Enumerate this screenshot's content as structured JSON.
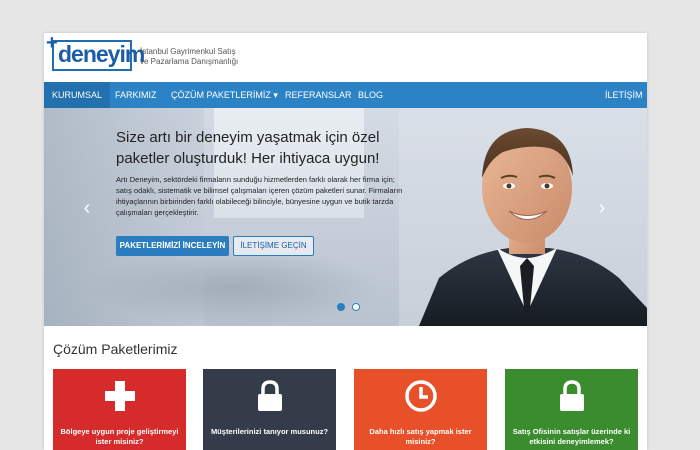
{
  "brand": {
    "logo_text": "deneyim",
    "logo_plus": "+",
    "tagline_line1": "İstanbul Gayrimenkul Satış",
    "tagline_line2": "ve Pazarlama Danışmanlığı",
    "color": "#1a5ea8"
  },
  "nav": {
    "items": [
      {
        "label": "KURUMSAL"
      },
      {
        "label": "FARKIMIZ"
      },
      {
        "label": "ÇÖZÜM PAKETLERİMİZ ▾"
      },
      {
        "label": "REFERANSLAR"
      },
      {
        "label": "BLOG"
      }
    ],
    "right_item": "İLETİŞİM",
    "color": "#2b83c6"
  },
  "hero": {
    "title": "Size artı bir deneyim yaşatmak için özel paketler oluşturduk! Her ihtiyaca uygun!",
    "text": "Artı Deneyim, sektördeki firmaların sunduğu hizmetlerden farklı olarak her firma için; satış odaklı, sistematik ve bilimsel çalışmaları içeren çözüm paketleri sunar. Firmaların ihtiyaçlarının birbirinden farklı olabileceği bilinciyle, bünyesine uygun ve butik tarzda çalışmaları gerçekleştirir.",
    "primary_button": "PAKETLERİMİZİ İNCELEYİN",
    "secondary_button": "İLETİŞİME GEÇİN",
    "arrow_left": "‹",
    "arrow_right": "›"
  },
  "section": {
    "title": "Çözüm Paketlerimiz"
  },
  "cards": [
    {
      "label": "Bölgeye uygun proje geliştirmeyi ister misiniz?",
      "icon": "plus-icon",
      "color": "#d52b2b"
    },
    {
      "label": "Müşterilerinizi tanıyor musunuz?",
      "icon": "lock-icon",
      "color": "#343c4a"
    },
    {
      "label": "Daha hızlı satış yapmak ister misiniz?",
      "icon": "clock-icon",
      "color": "#e8502a"
    },
    {
      "label": "Satış Ofisinin satışlar üzerinde ki etkisini deneyimlemek?",
      "icon": "lock-icon",
      "color": "#3a8c2e"
    }
  ]
}
